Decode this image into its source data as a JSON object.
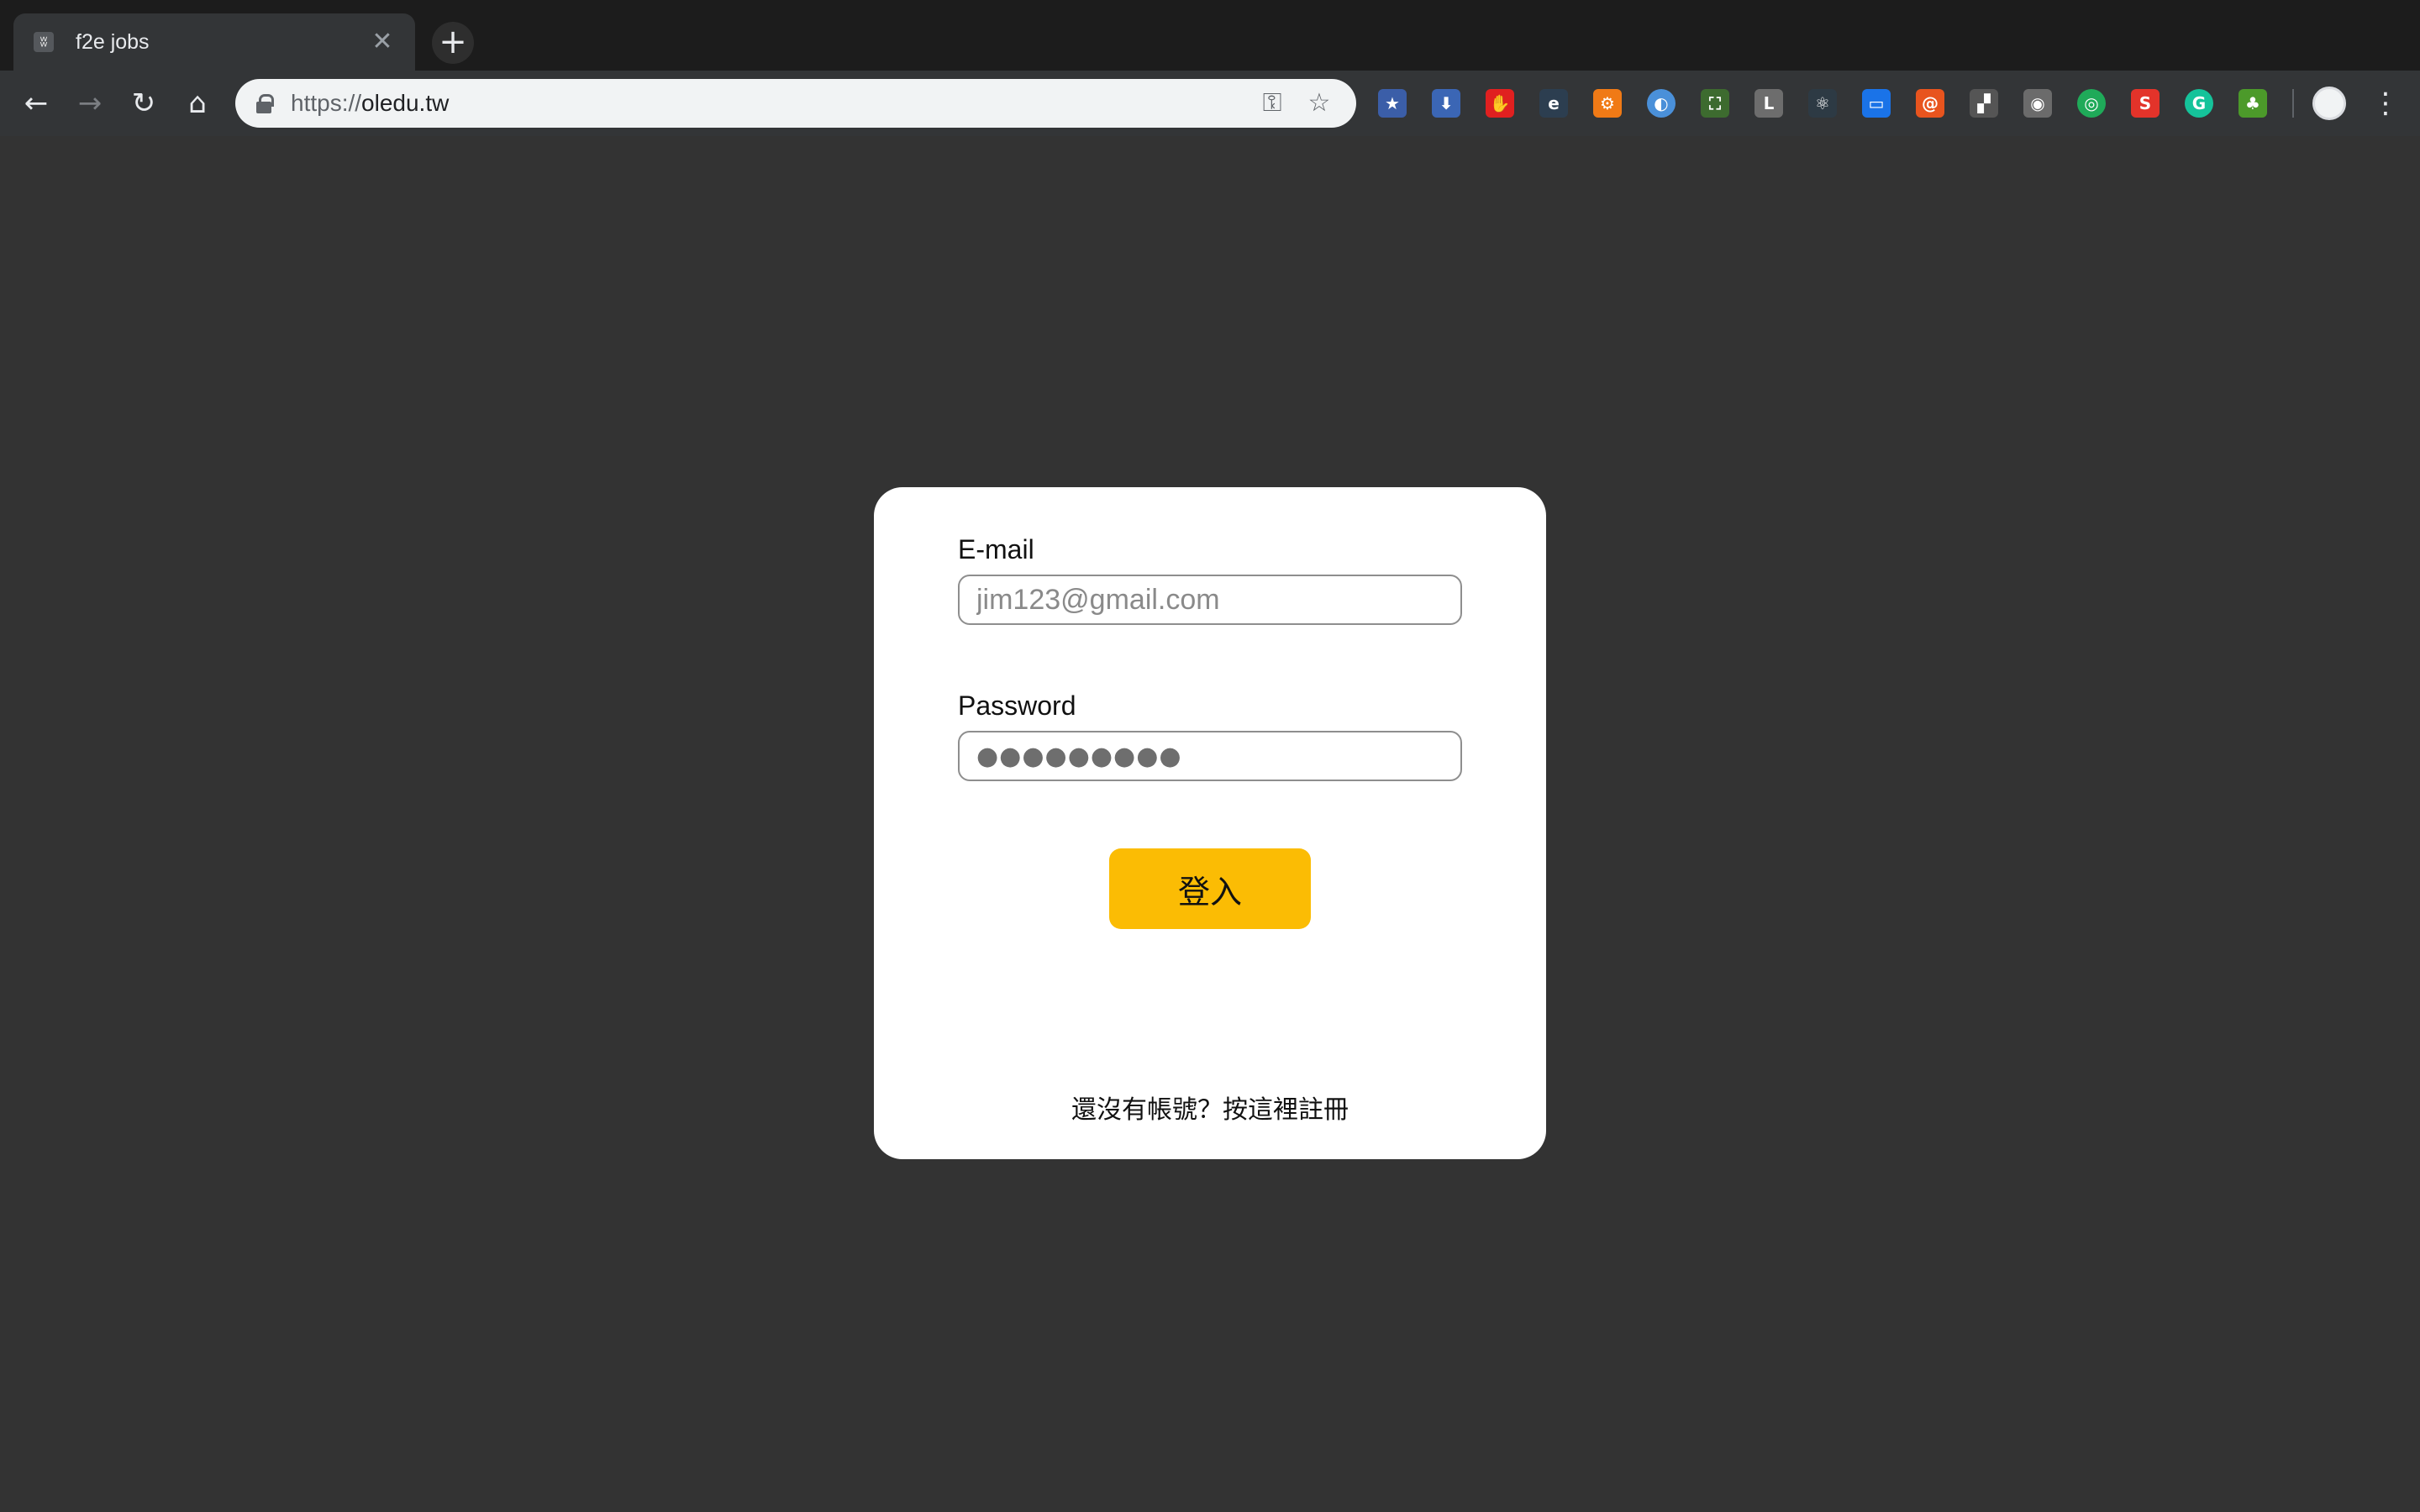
{
  "browser": {
    "tab": {
      "title": "f2e jobs",
      "favicon": "w-logo-icon",
      "close_glyph": "✕"
    },
    "new_tab_glyph": "+",
    "nav": {
      "back": "←",
      "forward": "→",
      "reload": "↻",
      "home": "⌂"
    },
    "address": {
      "scheme": "https://",
      "host": "oledu.tw"
    },
    "omnibox_icons": {
      "key": "⚿",
      "star": "☆"
    },
    "extensions": [
      {
        "name": "bookmark-star-extension-icon",
        "glyph": "★",
        "color": "#3b5ea8"
      },
      {
        "name": "download-extension-icon",
        "glyph": "⬇",
        "color": "#3b66b5"
      },
      {
        "name": "adblock-hand-extension-icon",
        "glyph": "✋",
        "color": "#e02020"
      },
      {
        "name": "e-extension-icon",
        "glyph": "e",
        "color": "#2c3e50"
      },
      {
        "name": "gear-extension-icon",
        "glyph": "⚙",
        "color": "#f07a16"
      },
      {
        "name": "circle-extension-icon",
        "glyph": "◐",
        "color": "#4a90d9"
      },
      {
        "name": "screen-capture-extension-icon",
        "glyph": "⛶",
        "color": "#3d6b2f"
      },
      {
        "name": "l-extension-icon",
        "glyph": "L",
        "color": "#6d6d6d"
      },
      {
        "name": "react-devtools-extension-icon",
        "glyph": "⚛",
        "color": "#2d3a44"
      },
      {
        "name": "monitor-extension-icon",
        "glyph": "▭",
        "color": "#1a73e8"
      },
      {
        "name": "swirl-extension-icon",
        "glyph": "@",
        "color": "#e8541e"
      },
      {
        "name": "blocks-extension-icon",
        "glyph": "▞",
        "color": "#555555"
      },
      {
        "name": "camera-extension-icon",
        "glyph": "◉",
        "color": "#6b6b6b"
      },
      {
        "name": "target-extension-icon",
        "glyph": "◎",
        "color": "#1faa59"
      },
      {
        "name": "s-extension-icon",
        "glyph": "S",
        "color": "#e3332a"
      },
      {
        "name": "grammarly-extension-icon",
        "glyph": "G",
        "color": "#15c39a"
      },
      {
        "name": "leaf-extension-icon",
        "glyph": "♣",
        "color": "#4c9a2a"
      }
    ],
    "menu_glyph": "⋮"
  },
  "login": {
    "email_label": "E-mail",
    "email_placeholder": "jim123@gmail.com",
    "password_label": "Password",
    "password_mask": "●●●●●●●●●",
    "submit_label": "登入",
    "signup_text": "還沒有帳號？按這裡註冊"
  },
  "colors": {
    "page_bg": "#333333",
    "card_bg": "#ffffff",
    "button_bg": "#fbbc04"
  }
}
